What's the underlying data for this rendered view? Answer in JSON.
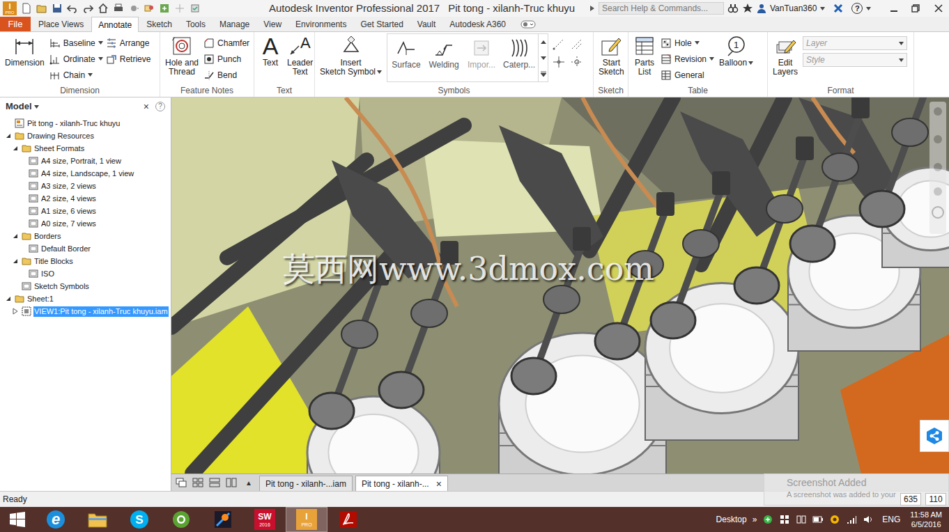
{
  "window": {
    "app": "Autodesk Inventor Professional 2017",
    "document": "Pit tong - xilanh-Truc khuyu",
    "app_icon": {
      "letter": "I",
      "tag": "PRO"
    }
  },
  "search": {
    "placeholder": "Search Help & Commands..."
  },
  "user": {
    "name": "VanTuan360"
  },
  "help": {
    "label": "?"
  },
  "tabs": [
    {
      "label": "File",
      "selected": false,
      "kind": "file"
    },
    {
      "label": "Place Views",
      "selected": false,
      "kind": "tab"
    },
    {
      "label": "Annotate",
      "selected": true,
      "kind": "tab"
    },
    {
      "label": "Sketch",
      "selected": false,
      "kind": "tab"
    },
    {
      "label": "Tools",
      "selected": false,
      "kind": "tab"
    },
    {
      "label": "Manage",
      "selected": false,
      "kind": "tab"
    },
    {
      "label": "View",
      "selected": false,
      "kind": "tab"
    },
    {
      "label": "Environments",
      "selected": false,
      "kind": "tab"
    },
    {
      "label": "Get Started",
      "selected": false,
      "kind": "tab"
    },
    {
      "label": "Vault",
      "selected": false,
      "kind": "tab"
    },
    {
      "label": "Autodesk A360",
      "selected": false,
      "kind": "tab"
    }
  ],
  "ribbon": {
    "panels": [
      {
        "label": "Dimension",
        "groups": [
          {
            "kind": "large",
            "tools": [
              {
                "lines": [
                  "Dimension"
                ],
                "dropdown": false,
                "disabled": false
              }
            ]
          },
          {
            "kind": "small",
            "tools": [
              {
                "label": "Baseline",
                "dropdown": true,
                "disabled": false
              },
              {
                "label": "Ordinate",
                "dropdown": true,
                "disabled": false
              },
              {
                "label": "Chain",
                "dropdown": true,
                "disabled": false
              }
            ]
          },
          {
            "kind": "small",
            "tools": [
              {
                "label": "Arrange",
                "dropdown": false,
                "disabled": false
              },
              {
                "label": "Retrieve",
                "dropdown": false,
                "disabled": false
              }
            ]
          }
        ]
      },
      {
        "label": "Feature Notes",
        "groups": [
          {
            "kind": "large",
            "tools": [
              {
                "lines": [
                  "Hole and",
                  "Thread"
                ],
                "dropdown": false,
                "disabled": false
              }
            ]
          },
          {
            "kind": "small",
            "tools": [
              {
                "label": "Chamfer",
                "dropdown": false,
                "disabled": false
              },
              {
                "label": "Punch",
                "dropdown": false,
                "disabled": false
              },
              {
                "label": "Bend",
                "dropdown": false,
                "disabled": false
              }
            ]
          }
        ]
      },
      {
        "label": "Text",
        "groups": [
          {
            "kind": "large",
            "tools": [
              {
                "lines": [
                  "Text"
                ],
                "dropdown": false,
                "disabled": false,
                "badge": "A"
              },
              {
                "lines": [
                  "Leader",
                  "Text"
                ],
                "dropdown": false,
                "disabled": false,
                "badge": "A"
              }
            ]
          }
        ]
      },
      {
        "label": "Symbols",
        "groups": [
          {
            "kind": "large",
            "tools": [
              {
                "lines": [
                  "Insert",
                  "Sketch Symbol"
                ],
                "dropdown": true,
                "disabled": false
              }
            ]
          },
          {
            "kind": "gallery",
            "tools": [
              {
                "lines": [
                  "Surface"
                ],
                "dropdown": false,
                "disabled": false
              },
              {
                "lines": [
                  "Welding"
                ],
                "dropdown": false,
                "disabled": false
              },
              {
                "lines": [
                  "Impor..."
                ],
                "dropdown": false,
                "disabled": true
              },
              {
                "lines": [
                  "Caterp..."
                ],
                "dropdown": false,
                "disabled": false
              }
            ]
          },
          {
            "kind": "icons",
            "tools": [
              {
                "disabled": false
              },
              {
                "disabled": false
              },
              {
                "disabled": false
              },
              {
                "disabled": false
              }
            ]
          }
        ]
      },
      {
        "label": "Sketch",
        "groups": [
          {
            "kind": "large",
            "tools": [
              {
                "lines": [
                  "Start",
                  "Sketch"
                ],
                "dropdown": false,
                "disabled": false
              }
            ]
          }
        ]
      },
      {
        "label": "Table",
        "groups": [
          {
            "kind": "large",
            "tools": [
              {
                "lines": [
                  "Parts",
                  "List"
                ],
                "dropdown": false,
                "disabled": false
              }
            ]
          },
          {
            "kind": "small",
            "tools": [
              {
                "label": "Hole",
                "dropdown": true,
                "disabled": false
              },
              {
                "label": "Revision",
                "dropdown": true,
                "disabled": false
              },
              {
                "label": "General",
                "dropdown": false,
                "disabled": false
              }
            ]
          },
          {
            "kind": "large",
            "tools": [
              {
                "lines": [
                  "Balloon"
                ],
                "dropdown": true,
                "disabled": false,
                "badge": "1"
              }
            ]
          }
        ]
      },
      {
        "label": "Format",
        "groups": [
          {
            "kind": "large",
            "tools": [
              {
                "lines": [
                  "Edit",
                  "Layers"
                ],
                "dropdown": false,
                "disabled": false
              }
            ]
          },
          {
            "kind": "fields",
            "tools": [
              {
                "value": "Layer",
                "disabled": true
              },
              {
                "value": "Style",
                "disabled": true
              }
            ]
          }
        ]
      }
    ]
  },
  "browser": {
    "title": "Model",
    "close": "×",
    "help": "?",
    "items": [
      {
        "label": "Pit tong - xilanh-Truc khuyu",
        "depth": 0,
        "expandable": false,
        "expanded": false,
        "selected": false
      },
      {
        "label": "Drawing Resources",
        "depth": 0,
        "expandable": true,
        "expanded": true,
        "selected": false
      },
      {
        "label": "Sheet Formats",
        "depth": 1,
        "expandable": true,
        "expanded": true,
        "selected": false
      },
      {
        "label": "A4 size, Portrait, 1 view",
        "depth": 2,
        "expandable": false,
        "expanded": false,
        "selected": false
      },
      {
        "label": "A4 size, Landscape, 1 view",
        "depth": 2,
        "expandable": false,
        "expanded": false,
        "selected": false
      },
      {
        "label": "A3 size, 2 views",
        "depth": 2,
        "expandable": false,
        "expanded": false,
        "selected": false
      },
      {
        "label": "A2 size, 4 views",
        "depth": 2,
        "expandable": false,
        "expanded": false,
        "selected": false
      },
      {
        "label": "A1 size, 6 views",
        "depth": 2,
        "expandable": false,
        "expanded": false,
        "selected": false
      },
      {
        "label": "A0 size, 7 views",
        "depth": 2,
        "expandable": false,
        "expanded": false,
        "selected": false
      },
      {
        "label": "Borders",
        "depth": 1,
        "expandable": true,
        "expanded": true,
        "selected": false
      },
      {
        "label": "Default Border",
        "depth": 2,
        "expandable": false,
        "expanded": false,
        "selected": false
      },
      {
        "label": "Title Blocks",
        "depth": 1,
        "expandable": true,
        "expanded": true,
        "selected": false
      },
      {
        "label": "ISO",
        "depth": 2,
        "expandable": false,
        "expanded": false,
        "selected": false
      },
      {
        "label": "Sketch Symbols",
        "depth": 1,
        "expandable": false,
        "expanded": false,
        "selected": false
      },
      {
        "label": "Sheet:1",
        "depth": 0,
        "expandable": true,
        "expanded": true,
        "selected": false
      },
      {
        "label": "VIEW1:Pit tong - xilanh-Truc khuyu.iam",
        "depth": 1,
        "expandable": true,
        "expanded": false,
        "selected": true
      }
    ]
  },
  "watermark": "莫西网www.3dmox.com",
  "doc_tabs": {
    "scroll": "▲",
    "tabs": [
      {
        "label": "Pit tong - xilanh-...iam",
        "selected": false
      },
      {
        "label": "Pit tong - xilanh-...",
        "selected": true,
        "close": "×"
      }
    ]
  },
  "status": {
    "text": "Ready",
    "coords": [
      "635",
      "110"
    ]
  },
  "toast": {
    "title": "Screenshot Added",
    "message": "A screenshot was added to your"
  },
  "taskbar": {
    "apps": [
      {
        "kind": "start",
        "selected": false
      },
      {
        "kind": "ie",
        "selected": false,
        "glyph": "e"
      },
      {
        "kind": "explorer",
        "selected": false
      },
      {
        "kind": "skype",
        "selected": false,
        "glyph": "S"
      },
      {
        "kind": "coccoc",
        "selected": false
      },
      {
        "kind": "app",
        "selected": false
      },
      {
        "kind": "solidworks",
        "selected": false,
        "glyph": "SW",
        "sub": "2016"
      },
      {
        "kind": "inventor",
        "selected": true,
        "glyph": "I",
        "sub": "PRO"
      },
      {
        "kind": "acrobat",
        "selected": false
      }
    ],
    "tray": {
      "desktop": "Desktop",
      "chevron": "»",
      "lang": "ENG",
      "time": "11:58 AM",
      "date": "6/5/2016"
    }
  }
}
